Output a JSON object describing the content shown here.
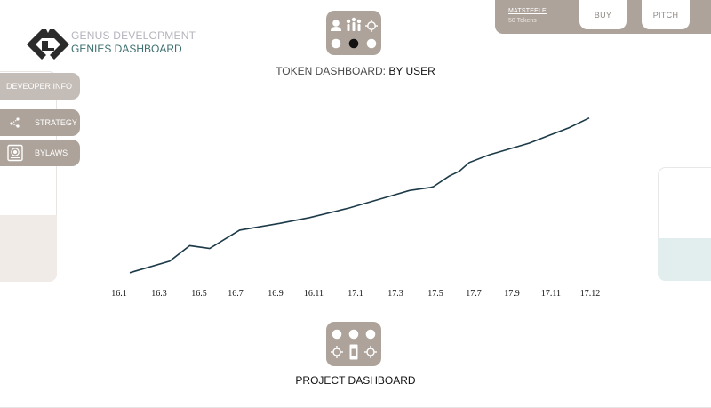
{
  "brand": {
    "line1": "GENUS DEVELOPMENT",
    "line2": "GENIES DASHBOARD"
  },
  "page_title": {
    "prefix": "TOKEN DASHBOARD:",
    "strong": "BY USER"
  },
  "user": {
    "name": "MATSTEELE",
    "tokens": "50 Tokens"
  },
  "top_buttons": {
    "buy": "BUY",
    "pitch": "PITCH"
  },
  "menu": {
    "developer": "DEVEOPER INFO",
    "strategy": "STRATEGY",
    "bylaws": "BYLAWS"
  },
  "bottom_title": "PROJECT DASHBOARD",
  "colors": {
    "tile": "#ada39a",
    "line": "#1c3a48",
    "accent": "#3d6f70"
  },
  "chart_data": {
    "type": "line",
    "title": "",
    "xlabel": "",
    "ylabel": "",
    "categories": [
      "16.1",
      "16.3",
      "16.5",
      "16.7",
      "16.9",
      "16.11",
      "17.1",
      "17.3",
      "17.5",
      "17.7",
      "17.9",
      "17.11",
      "17.12"
    ],
    "x": [
      0,
      2,
      4,
      6,
      8,
      10,
      12,
      14,
      16,
      18,
      20,
      22,
      23
    ],
    "y": [
      2,
      14,
      30,
      26,
      51,
      59,
      75,
      88,
      95,
      124,
      136,
      152,
      162
    ],
    "series": [
      {
        "points": [
          [
            0,
            2
          ],
          [
            2,
            14
          ],
          [
            3,
            30
          ],
          [
            4,
            27
          ],
          [
            5.5,
            46
          ],
          [
            7.5,
            53
          ],
          [
            9,
            59
          ],
          [
            11,
            69
          ],
          [
            12,
            75
          ],
          [
            13,
            81
          ],
          [
            14,
            87
          ],
          [
            15,
            90
          ],
          [
            15.2,
            91
          ],
          [
            16,
            102
          ],
          [
            16.5,
            107
          ],
          [
            17,
            116
          ],
          [
            18,
            124
          ],
          [
            20,
            136
          ],
          [
            21,
            144
          ],
          [
            22,
            152
          ],
          [
            23,
            162
          ]
        ]
      }
    ],
    "ylim": [
      0,
      170
    ],
    "grid": false,
    "legend": "none"
  }
}
